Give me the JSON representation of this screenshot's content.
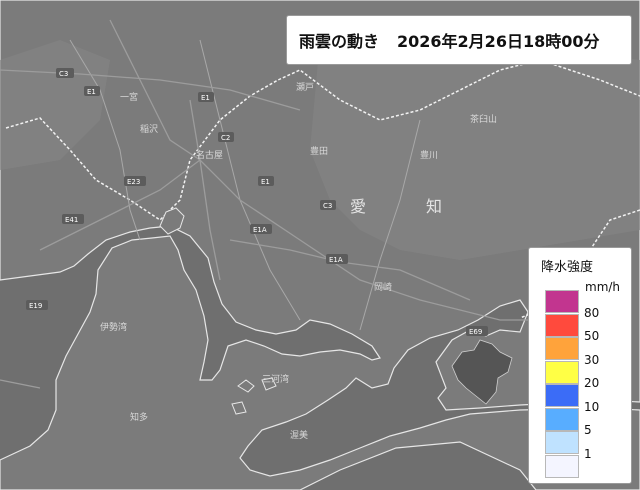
{
  "header": {
    "title": "雨雲の動き",
    "timestamp": "2026年2月26日18時00分"
  },
  "legend": {
    "title": "降水強度",
    "unit": "mm/h",
    "levels": [
      {
        "value": "80",
        "color": "#c2358f"
      },
      {
        "value": "50",
        "color": "#ff4a3d"
      },
      {
        "value": "30",
        "color": "#ffa33b"
      },
      {
        "value": "20",
        "color": "#ffff45"
      },
      {
        "value": "10",
        "color": "#3b6cf7"
      },
      {
        "value": "5",
        "color": "#58adff"
      },
      {
        "value": "1",
        "color": "#bfe2ff"
      },
      {
        "value": "",
        "color": "#f4f5ff"
      }
    ]
  },
  "map": {
    "prefecture_chars": [
      "愛",
      "知"
    ],
    "place_labels": [
      "名古屋",
      "豊田",
      "瀬戸",
      "一宮",
      "稲沢",
      "豊川",
      "岡崎",
      "三河湾",
      "伊勢湾",
      "知多",
      "渥美",
      "茶臼山"
    ],
    "road_badges": [
      "C3",
      "E1",
      "E1",
      "C2",
      "E1A",
      "E23",
      "E41",
      "E69",
      "E1A",
      "E1",
      "C3",
      "E19"
    ]
  }
}
